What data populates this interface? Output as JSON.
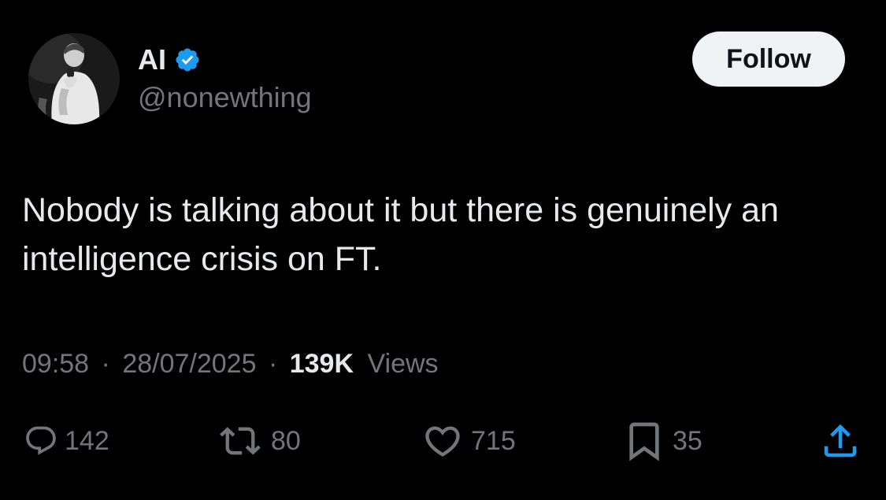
{
  "user": {
    "display_name": "AI",
    "handle": "@nonewthing",
    "verified": true,
    "verified_color": "#1d9bf0"
  },
  "follow_label": "Follow",
  "tweet": {
    "text": "Nobody is talking about it but there is genuinely an intelligence crisis on FT."
  },
  "meta": {
    "time": "09:58",
    "separator": "·",
    "date": "28/07/2025",
    "views_count": "139K",
    "views_label": "Views"
  },
  "actions": {
    "reply": {
      "icon": "reply-icon",
      "count": "142"
    },
    "retweet": {
      "icon": "retweet-icon",
      "count": "80"
    },
    "like": {
      "icon": "heart-icon",
      "count": "715"
    },
    "bookmark": {
      "icon": "bookmark-icon",
      "count": "35"
    },
    "share": {
      "icon": "share-icon"
    }
  },
  "colors": {
    "background": "#000000",
    "primary_text": "#e7e9ea",
    "secondary_text": "#71767b",
    "follow_bg": "#eff3f4",
    "follow_text": "#0f1419"
  }
}
